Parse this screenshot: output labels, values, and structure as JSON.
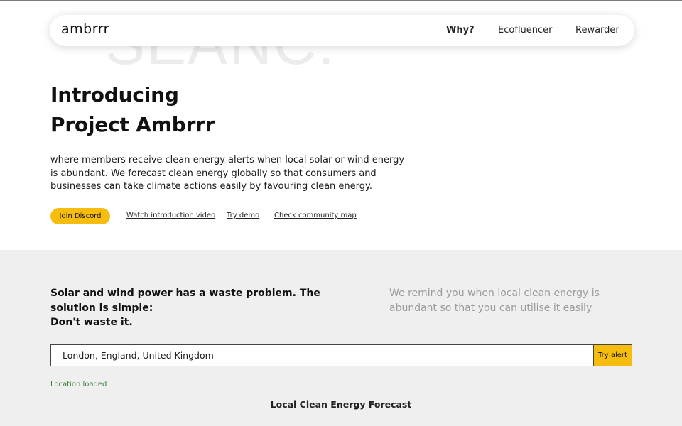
{
  "watermark": "SEANC.",
  "nav": {
    "logo": "ambrrr",
    "links": [
      "Why?",
      "Ecofluencer",
      "Rewarder"
    ]
  },
  "hero": {
    "title_lines": [
      "Introducing",
      "Project Ambrrr"
    ],
    "description": "where members receive clean energy alerts when local solar or wind energy is abundant. We forecast clean energy globally so that consumers and businesses can take climate actions easily by favouring clean energy.",
    "cta_label": "Join Discord",
    "links": [
      "Watch introduction video",
      "Try demo",
      "Check community map"
    ]
  },
  "problem": {
    "lines": [
      "Solar and wind power has a waste problem. The",
      "solution is simple:",
      "Don't waste it."
    ],
    "reminder": "We remind you when local clean energy is abundant so that you can utilise it easily."
  },
  "search": {
    "value": "London, England, United Kingdom",
    "button_label": "Try alert",
    "status": "Location loaded"
  },
  "forecast": {
    "heading": "Local Clean Energy Forecast"
  },
  "colors": {
    "accent": "#f6bd0f",
    "section_bg": "#efefef",
    "status_green": "#2f7d2f",
    "muted_text": "#9b9b9b"
  }
}
